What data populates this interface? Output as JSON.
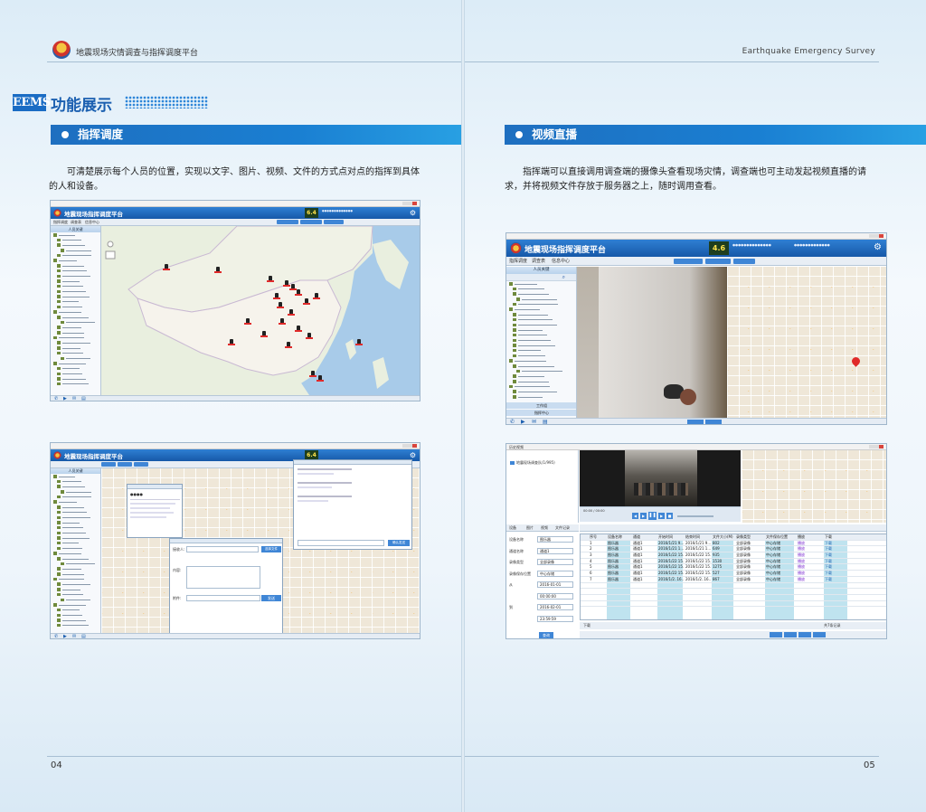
{
  "header": {
    "left_title": "地震现场灾情调查与指挥调度平台",
    "right_title": "Earthquake Emergency Survey"
  },
  "section": {
    "badge": "EEMS",
    "title": "功能展示"
  },
  "left": {
    "bar_title": "指挥调度",
    "paragraph": "可清楚展示每个人员的位置，实现以文字、图片、视频、文件的方式点对点的指挥到具体的人和设备。",
    "page_number": "04"
  },
  "right": {
    "bar_title": "视频直播",
    "paragraph": "指挥端可以直接调用调查端的摄像头查看现场灾情，调查端也可主动发起视频直播的请求，并将视频文件存放于服务器之上，随时调用查看。",
    "page_number": "05"
  },
  "app": {
    "title": "地震现场指挥调度平台",
    "magnitude": "6.4",
    "magnitude_b": "4.6",
    "menus": [
      "指挥调度",
      "调查表",
      "信息中心"
    ],
    "tree_head": "人员关键",
    "tree_head_b": "人员关键",
    "work_label": "工作组",
    "dispatch_label": "指挥中心",
    "dlg_label_send": "接收人:",
    "dlg_label_content": "内容:",
    "dlg_label_file": "附件:",
    "dlg_btn_send": "发送",
    "dlg_btn_select": "选择文件",
    "chat_btn": "确认发送"
  },
  "video_query": {
    "menu_label": "历史视频",
    "tree_item": "地震现场调查队(1/995)",
    "tabs": [
      "设备",
      "图片",
      "视频",
      "文件记录"
    ],
    "form": [
      {
        "label": "设备名称",
        "value": "图乐器"
      },
      {
        "label": "通道名称",
        "value": "通道1"
      },
      {
        "label": "录像类型",
        "value": "全部录像"
      },
      {
        "label": "录像保存位置",
        "value": "中心存储"
      },
      {
        "label": "从",
        "value": "2016-01-01"
      },
      {
        "label": "",
        "value": "00:00:00"
      },
      {
        "label": "到",
        "value": "2016-02-01"
      },
      {
        "label": "",
        "value": "23:59:59"
      }
    ],
    "query_btn": "查询",
    "table_headers": [
      "序号",
      "设备名称",
      "通道",
      "开始时间",
      "结束时间",
      "文件大小(M)",
      "录像类型",
      "文件保存位置",
      "播放",
      "下载"
    ],
    "rows": [
      [
        "1",
        "图乐器",
        "通道1",
        "2016/1/21 9...",
        "2016/1/21 9...",
        "802",
        "全部录像",
        "中心存储",
        "播放",
        "下载"
      ],
      [
        "2",
        "图乐器",
        "通道1",
        "2016/1/21 1...",
        "2016/1/21 1...",
        "649",
        "全部录像",
        "中心存储",
        "播放",
        "下载"
      ],
      [
        "3",
        "图乐器",
        "通道1",
        "2016/1/22 15...",
        "2016/1/22 15...",
        "935",
        "全部录像",
        "中心存储",
        "播放",
        "下载"
      ],
      [
        "4",
        "图乐器",
        "通道1",
        "2016/1/22 15...",
        "2016/1/22 15...",
        "1530",
        "全部录像",
        "中心存储",
        "播放",
        "下载"
      ],
      [
        "5",
        "图乐器",
        "通道1",
        "2016/1/22 15...",
        "2016/1/22 15...",
        "1275",
        "全部录像",
        "中心存储",
        "播放",
        "下载"
      ],
      [
        "6",
        "图乐器",
        "通道1",
        "2016/1/22 15...",
        "2016/1/22 15...",
        "527",
        "全部录像",
        "中心存储",
        "播放",
        "下载"
      ],
      [
        "7",
        "图乐器",
        "通道1",
        "2016/1/2..16...",
        "2016/1/2..16...",
        "867",
        "全部录像",
        "中心存储",
        "播放",
        "下载"
      ]
    ],
    "footer_left": "下载",
    "footer_right": "共7条记录"
  },
  "colors": {
    "accent_blue": "#1a6cc4",
    "bar_blue": "#1e6fc0",
    "pin_red": "#e02a2a"
  }
}
